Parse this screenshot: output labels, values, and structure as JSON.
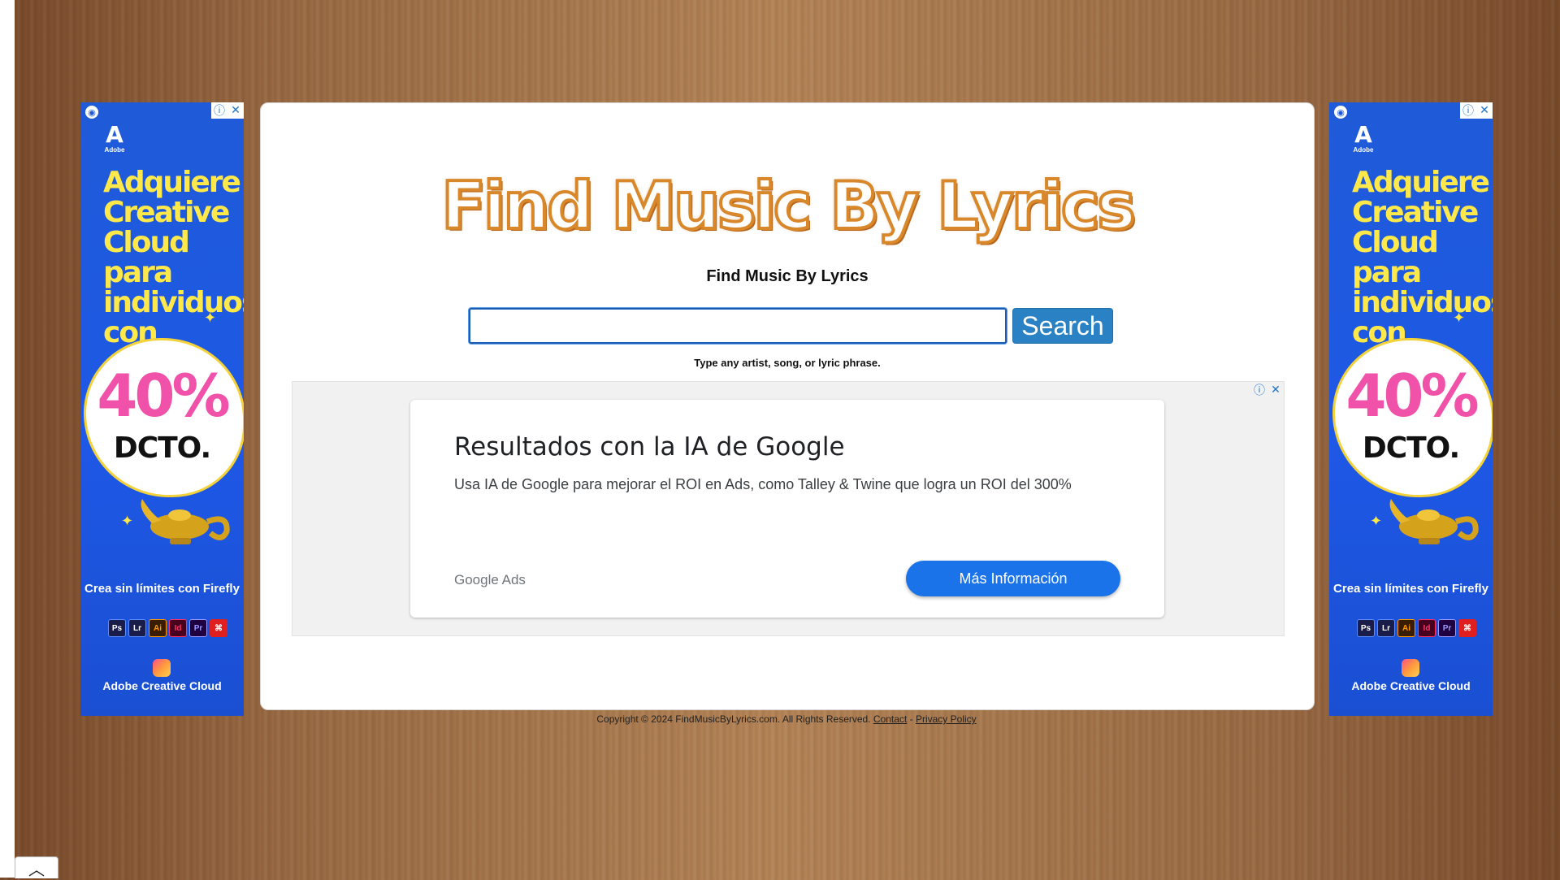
{
  "side_ad": {
    "brand": "Adobe",
    "headline": "Adquiere Creative Cloud para individuos con",
    "discount": "40%",
    "discount_label": "DCTO.",
    "subline": "Crea sin límites con Firefly",
    "app_icons": [
      "Ps",
      "Lr",
      "Ai",
      "Id",
      "Pr",
      "Ac"
    ],
    "footer_label": "Adobe Creative Cloud",
    "info_icon": "info-icon",
    "close_icon": "close-icon"
  },
  "header": {
    "logo_text": "Find Music By Lyrics",
    "title": "Find Music By Lyrics"
  },
  "search": {
    "value": "",
    "placeholder": "",
    "button_label": "Search",
    "hint": "Type any artist, song, or lyric phrase."
  },
  "inline_ad": {
    "title": "Resultados con la IA de Google",
    "description": "Usa IA de Google para mejorar el ROI en Ads, como Talley & Twine que logra un ROI del 300%",
    "brand": "Google Ads",
    "cta_label": "Más Información"
  },
  "footer": {
    "copyright": "Copyright © 2024 FindMusicByLyrics.com. All Rights Reserved.",
    "contact_label": "Contact",
    "separator": "-",
    "privacy_label": "Privacy Policy"
  },
  "scroll_top": {
    "icon": "chevron-up-icon",
    "glyph": "︿"
  },
  "colors": {
    "ad_blue": "#1f5bd8",
    "ad_yellow": "#ffe84a",
    "discount_pink": "#ef52a8",
    "search_button": "#2a82c4",
    "logo_outline": "#d8872a",
    "cta_blue": "#1a73e8"
  }
}
